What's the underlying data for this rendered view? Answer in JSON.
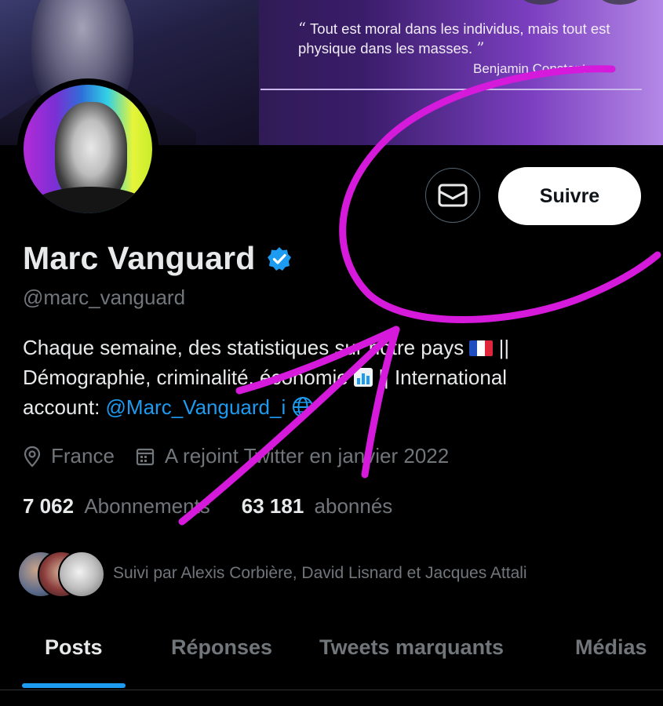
{
  "banner": {
    "quote_open": "“",
    "quote_text": "Tout est moral dans les individus, mais tout est physique dans les masses.",
    "quote_close": "”",
    "quote_author": "Benjamin Constant"
  },
  "actions": {
    "message_icon": "envelope-icon",
    "follow_label": "Suivre"
  },
  "profile": {
    "name": "Marc Vanguard",
    "verified": true,
    "handle": "@marc_vanguard",
    "bio": {
      "line1_prefix": "Chaque semaine, des statistiques sur notre pays",
      "line1_suffix": "||",
      "line2_prefix": "Démographie, criminalité, économie",
      "line2_suffix": "|| International",
      "line3_prefix": "account:",
      "line3_link": "@Marc_Vanguard_i"
    },
    "location": "France",
    "joined": "A rejoint Twitter en janvier 2022",
    "following_count": "7 062",
    "following_label": "Abonnements",
    "followers_count": "63 181",
    "followers_label": "abonnés",
    "followed_by": "Suivi par Alexis Corbière, David Lisnard et Jacques Attali"
  },
  "tabs": [
    {
      "label": "Posts",
      "active": true
    },
    {
      "label": "Réponses",
      "active": false
    },
    {
      "label": "Tweets marquants",
      "active": false
    },
    {
      "label": "Médias",
      "active": false
    }
  ],
  "colors": {
    "accent": "#1d9bf0",
    "annotation": "#d61adb",
    "background": "#000000",
    "muted": "#71767b"
  }
}
